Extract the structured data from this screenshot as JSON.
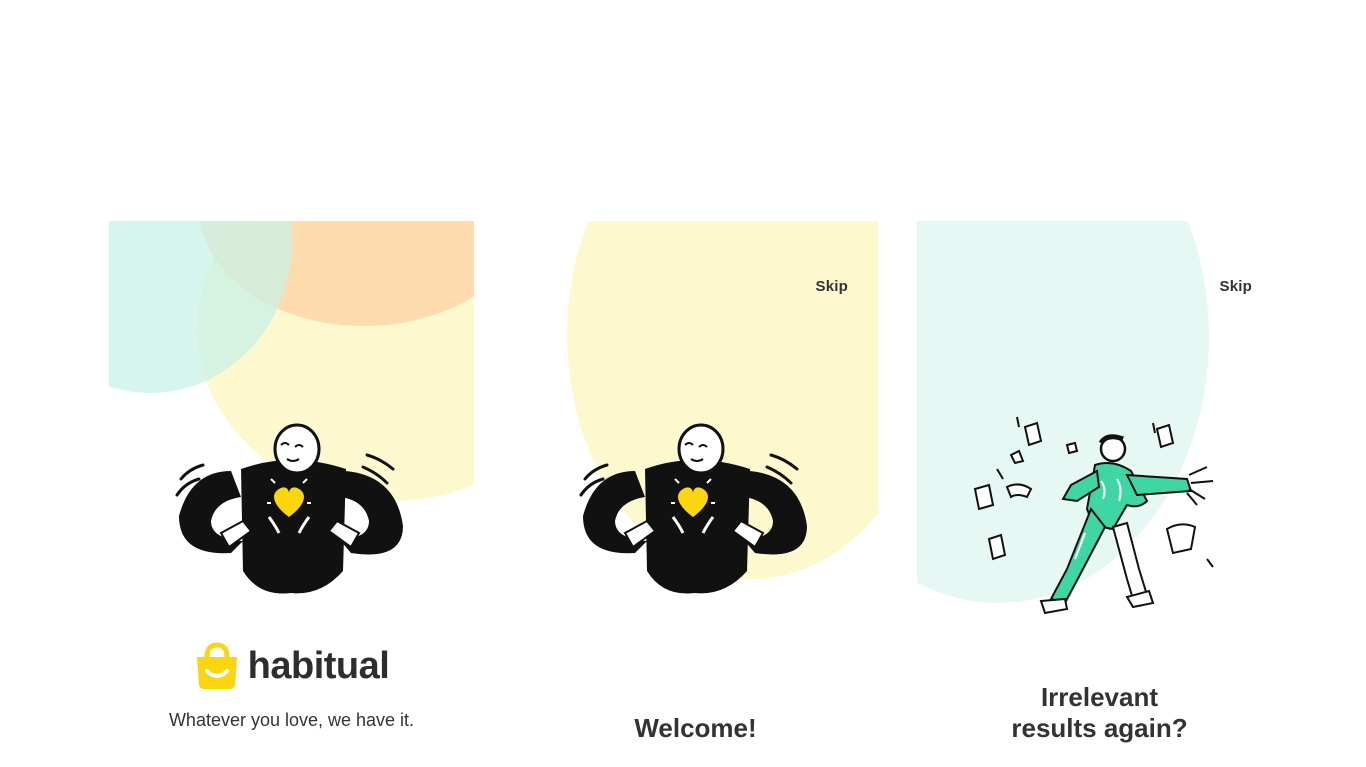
{
  "screens": {
    "splash": {
      "brand_name": "habitual",
      "tagline": "Whatever you love, we have it."
    },
    "welcome": {
      "skip_label": "Skip",
      "headline": "Welcome!"
    },
    "irrelevant": {
      "skip_label": "Skip",
      "headline_line1": "Irrelevant",
      "headline_line2": "results again?"
    }
  },
  "colors": {
    "brand_yellow": "#fbd60f",
    "mint": "#cdf3ea",
    "peach": "#fcd8b0",
    "cream": "#fef8cf",
    "illustration_green": "#3ed6a4",
    "ink": "#111111"
  },
  "icons": {
    "logo": "shopping-bag-smile-icon"
  }
}
